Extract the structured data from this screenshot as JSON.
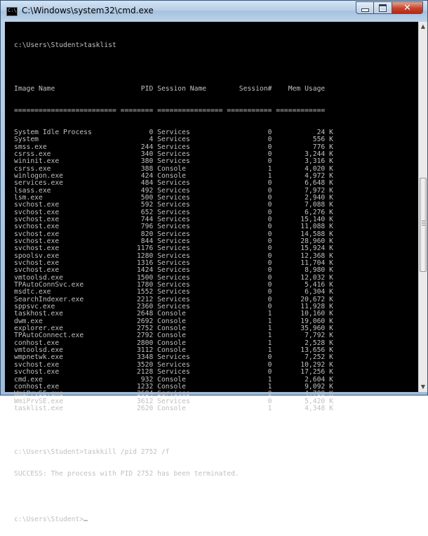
{
  "window": {
    "title": "C:\\Windows\\system32\\cmd.exe",
    "icon_label": "C:\\",
    "buttons": {
      "minimize": "minimize",
      "maximize": "maximize",
      "close": "✕"
    }
  },
  "console": {
    "prompt1": "c:\\Users\\Student>tasklist",
    "header": "Image Name                     PID Session Name        Session#    Mem Usage",
    "separator": "========================= ======== ================ =========== ============",
    "rows": [
      "System Idle Process              0 Services                   0           24 K",
      "System                           4 Services                   0          556 K",
      "smss.exe                       244 Services                   0          776 K",
      "csrss.exe                      340 Services                   0        3,244 K",
      "wininit.exe                    380 Services                   0        3,316 K",
      "csrss.exe                      388 Console                    1        4,020 K",
      "winlogon.exe                   424 Console                    1        4,972 K",
      "services.exe                   484 Services                   0        6,648 K",
      "lsass.exe                      492 Services                   0        7,972 K",
      "lsm.exe                        500 Services                   0        2,940 K",
      "svchost.exe                    592 Services                   0        7,088 K",
      "svchost.exe                    652 Services                   0        6,276 K",
      "svchost.exe                    744 Services                   0       15,140 K",
      "svchost.exe                    796 Services                   0       11,088 K",
      "svchost.exe                    820 Services                   0       14,588 K",
      "svchost.exe                    844 Services                   0       28,960 K",
      "svchost.exe                   1176 Services                   0       15,924 K",
      "spoolsv.exe                   1280 Services                   0       12,368 K",
      "svchost.exe                   1316 Services                   0       11,704 K",
      "svchost.exe                   1424 Services                   0        8,980 K",
      "vmtoolsd.exe                  1500 Services                   0       12,032 K",
      "TPAutoConnSvc.exe             1780 Services                   0        5,416 K",
      "msdtc.exe                     1552 Services                   0        6,304 K",
      "SearchIndexer.exe             2212 Services                   0       20,672 K",
      "sppsvc.exe                    2360 Services                   0       11,928 K",
      "taskhost.exe                  2648 Console                    1       10,160 K",
      "dwm.exe                       2692 Console                    1       19,060 K",
      "explorer.exe                  2752 Console                    1       35,960 K",
      "TPAutoConnect.exe             2792 Console                    1        7,792 K",
      "conhost.exe                   2800 Console                    1        2,528 K",
      "vmtoolsd.exe                  3112 Console                    1       13,656 K",
      "wmpnetwk.exe                  3348 Services                   0        7,252 K",
      "svchost.exe                   3520 Services                   0       10,292 K",
      "svchost.exe                   2128 Services                   0       17,256 K",
      "cmd.exe                        932 Console                    1        2,604 K",
      "conhost.exe                   1232 Console                    1        9,092 K",
      "WmiPrvSE.exe                  3684 Services                   0        4,788 K",
      "WmiPrvSE.exe                  3612 Services                   0        5,420 K",
      "tasklist.exe                  2620 Console                    1        4,348 K"
    ],
    "prompt2": "c:\\Users\\Student>taskkill /pid 2752 /f",
    "result": "SUCCESS: The process with PID 2752 has been terminated.",
    "prompt3": "c:\\Users\\Student>"
  }
}
